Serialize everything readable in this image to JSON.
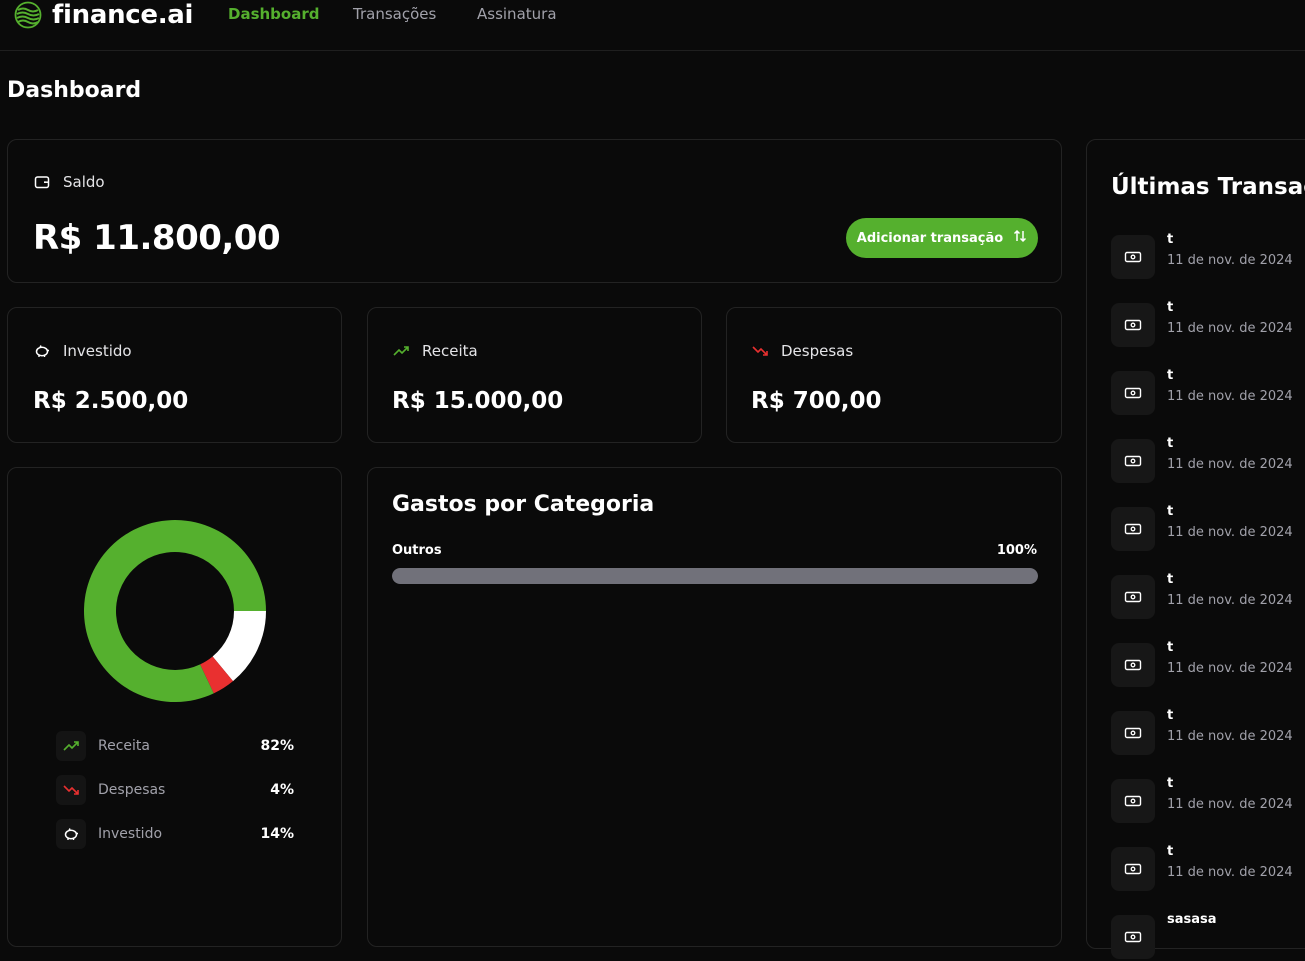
{
  "app": {
    "logo_text": "finance.ai"
  },
  "nav": {
    "items": [
      "Dashboard",
      "Transações",
      "Assinatura"
    ],
    "active": "Dashboard"
  },
  "page": {
    "title": "Dashboard"
  },
  "balance": {
    "label": "Saldo",
    "value": "R$ 11.800,00",
    "add_button_label": "Adicionar transação"
  },
  "summary": {
    "investido": {
      "label": "Investido",
      "value": "R$ 2.500,00"
    },
    "receita": {
      "label": "Receita",
      "value": "R$ 15.000,00"
    },
    "despesas": {
      "label": "Despesas",
      "value": "R$ 700,00"
    }
  },
  "chart_data": {
    "type": "pie",
    "donut": true,
    "slices": [
      {
        "label": "Receita",
        "value": 82,
        "color": "#55b02e"
      },
      {
        "label": "Despesas",
        "value": 4,
        "color": "#e93030"
      },
      {
        "label": "Investido",
        "value": 14,
        "color": "#ffffff"
      }
    ]
  },
  "legend": [
    {
      "label": "Receita",
      "pct": "82%"
    },
    {
      "label": "Despesas",
      "pct": "4%"
    },
    {
      "label": "Investido",
      "pct": "14%"
    }
  ],
  "categories": {
    "title": "Gastos por Categoria",
    "items": [
      {
        "name": "Outros",
        "pct_label": "100%",
        "fraction": 1.0
      }
    ]
  },
  "transactions": {
    "title": "Últimas Transações",
    "items": [
      {
        "name": "t",
        "date": "11 de nov. de 2024"
      },
      {
        "name": "t",
        "date": "11 de nov. de 2024"
      },
      {
        "name": "t",
        "date": "11 de nov. de 2024"
      },
      {
        "name": "t",
        "date": "11 de nov. de 2024"
      },
      {
        "name": "t",
        "date": "11 de nov. de 2024"
      },
      {
        "name": "t",
        "date": "11 de nov. de 2024"
      },
      {
        "name": "t",
        "date": "11 de nov. de 2024"
      },
      {
        "name": "t",
        "date": "11 de nov. de 2024"
      },
      {
        "name": "t",
        "date": "11 de nov. de 2024"
      },
      {
        "name": "t",
        "date": "11 de nov. de 2024"
      },
      {
        "name": "sasasa",
        "date": ""
      }
    ]
  },
  "colors": {
    "accent": "#55b02e",
    "danger": "#e93030",
    "background": "#0a0a0a",
    "card_border": "#232323",
    "muted_text": "#a1a1aa"
  }
}
